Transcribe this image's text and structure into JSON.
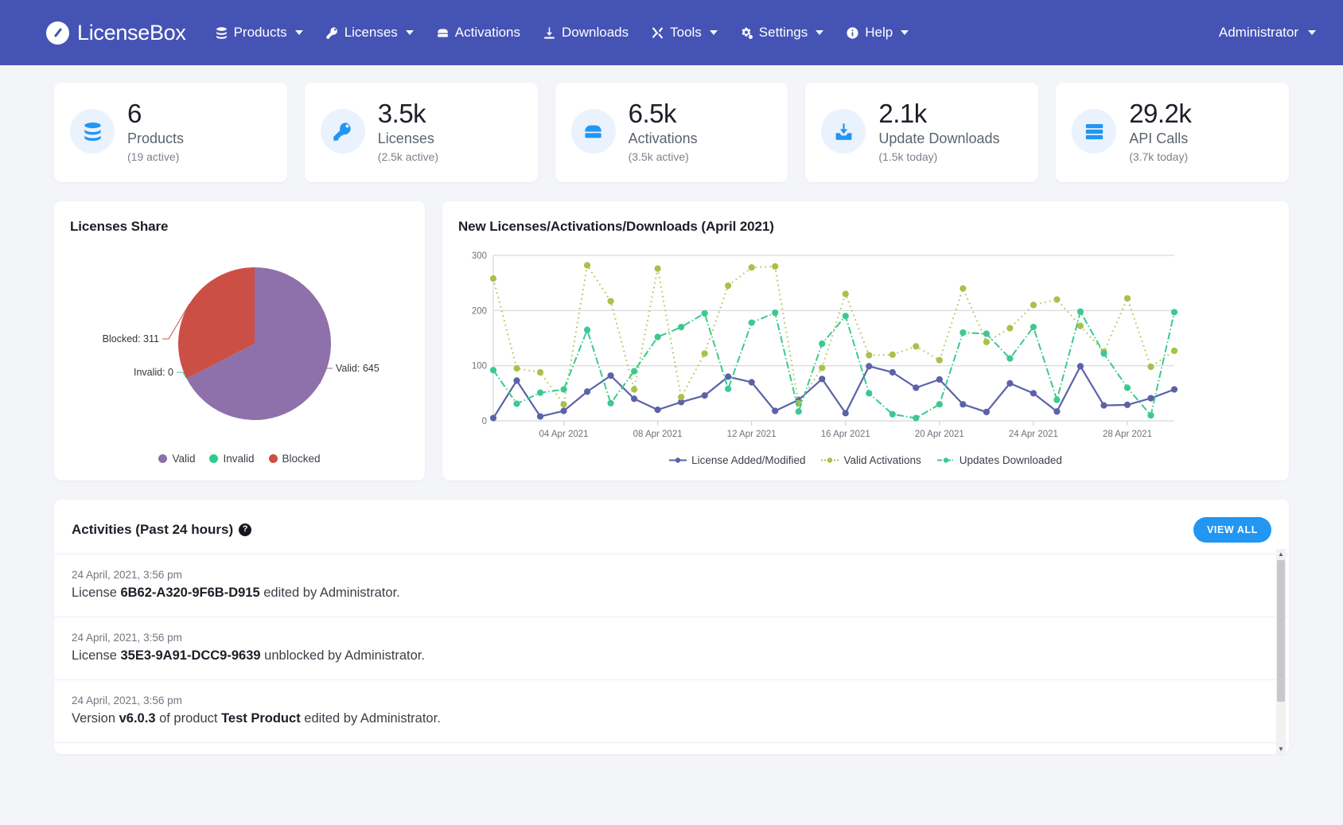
{
  "navbar": {
    "brand": "LicenseBox",
    "brand_icon": "licensebox-logo-icon",
    "items": [
      {
        "label": "Products",
        "icon": "database-icon",
        "caret": true
      },
      {
        "label": "Licenses",
        "icon": "key-icon",
        "caret": true
      },
      {
        "label": "Activations",
        "icon": "server-icon",
        "caret": false
      },
      {
        "label": "Downloads",
        "icon": "download-icon",
        "caret": false
      },
      {
        "label": "Tools",
        "icon": "tools-icon",
        "caret": true
      },
      {
        "label": "Settings",
        "icon": "gears-icon",
        "caret": true
      },
      {
        "label": "Help",
        "icon": "info-icon",
        "caret": true
      }
    ],
    "user": {
      "label": "Administrator",
      "caret": true
    },
    "bg_color": "#4553b5"
  },
  "stats": [
    {
      "value": "6",
      "label": "Products",
      "sub": "(19 active)",
      "icon": "database-icon"
    },
    {
      "value": "3.5k",
      "label": "Licenses",
      "sub": "(2.5k active)",
      "icon": "key-icon"
    },
    {
      "value": "6.5k",
      "label": "Activations",
      "sub": "(3.5k active)",
      "icon": "server-icon"
    },
    {
      "value": "2.1k",
      "label": "Update Downloads",
      "sub": "(1.5k today)",
      "icon": "download-box-icon"
    },
    {
      "value": "29.2k",
      "label": "API Calls",
      "sub": "(3.7k today)",
      "icon": "api-rack-icon"
    }
  ],
  "pie_card": {
    "title": "Licenses Share"
  },
  "line_card": {
    "title": "New Licenses/Activations/Downloads (April 2021)"
  },
  "activities": {
    "title": "Activities (Past 24 hours)",
    "help_icon": "question-mark-icon",
    "view_all_label": "VIEW ALL",
    "rows": [
      {
        "time": "24 April, 2021, 3:56 pm",
        "pre": "License ",
        "bold": "6B62-A320-9F6B-D915",
        "post": " edited by Administrator."
      },
      {
        "time": "24 April, 2021, 3:56 pm",
        "pre": "License ",
        "bold": "35E3-9A91-DCC9-9639",
        "post": " unblocked by Administrator."
      },
      {
        "time": "24 April, 2021, 3:56 pm",
        "pre": "Version ",
        "bold": "v6.0.3",
        "mid": " of product ",
        "bold2": "Test Product",
        "post": " edited by Administrator."
      }
    ]
  },
  "chart_data": [
    {
      "type": "pie",
      "title": "Licenses Share",
      "legend_position": "bottom",
      "labels": [
        "Valid",
        "Invalid",
        "Blocked"
      ],
      "values": [
        645,
        0,
        311
      ],
      "colors": [
        "#8e71ab",
        "#2ecc8f",
        "#cc4f45"
      ],
      "annotations": [
        "Valid: 645",
        "Invalid: 0",
        "Blocked: 311"
      ]
    },
    {
      "type": "line",
      "title": "New Licenses/Activations/Downloads (April 2021)",
      "xlabel": "",
      "ylabel": "",
      "ylim": [
        0,
        300
      ],
      "yticks": [
        0,
        100,
        200,
        300
      ],
      "grid": true,
      "legend_position": "bottom",
      "x": [
        "01 Apr 2021",
        "02 Apr 2021",
        "03 Apr 2021",
        "04 Apr 2021",
        "05 Apr 2021",
        "06 Apr 2021",
        "07 Apr 2021",
        "08 Apr 2021",
        "09 Apr 2021",
        "10 Apr 2021",
        "11 Apr 2021",
        "12 Apr 2021",
        "13 Apr 2021",
        "14 Apr 2021",
        "15 Apr 2021",
        "16 Apr 2021",
        "17 Apr 2021",
        "18 Apr 2021",
        "19 Apr 2021",
        "20 Apr 2021",
        "21 Apr 2021",
        "22 Apr 2021",
        "23 Apr 2021",
        "24 Apr 2021",
        "25 Apr 2021",
        "26 Apr 2021",
        "27 Apr 2021",
        "28 Apr 2021",
        "29 Apr 2021",
        "30 Apr 2021"
      ],
      "xtick_labels": [
        "04 Apr 2021",
        "08 Apr 2021",
        "12 Apr 2021",
        "16 Apr 2021",
        "20 Apr 2021",
        "24 Apr 2021",
        "28 Apr 2021"
      ],
      "xtick_indices": [
        3,
        7,
        11,
        15,
        19,
        23,
        27
      ],
      "series": [
        {
          "name": "License Added/Modified",
          "color": "#5b62a8",
          "style": "solid",
          "values": [
            5,
            73,
            8,
            18,
            53,
            82,
            40,
            20,
            34,
            46,
            80,
            70,
            18,
            38,
            76,
            14,
            99,
            88,
            60,
            75,
            30,
            16,
            68,
            50,
            17,
            99,
            28,
            29,
            41,
            57
          ]
        },
        {
          "name": "Valid Activations",
          "color": "#a8c14a",
          "style": "dotted",
          "values": [
            258,
            95,
            88,
            30,
            282,
            217,
            57,
            276,
            43,
            122,
            245,
            278,
            280,
            32,
            96,
            230,
            119,
            120,
            135,
            110,
            240,
            143,
            168,
            210,
            220,
            172,
            125,
            222,
            98,
            127
          ]
        },
        {
          "name": "Updates Downloaded",
          "color": "#3cc98f",
          "style": "dashdot",
          "values": [
            92,
            31,
            51,
            57,
            165,
            32,
            90,
            152,
            170,
            195,
            58,
            178,
            196,
            17,
            140,
            190,
            50,
            12,
            5,
            30,
            160,
            158,
            113,
            170,
            38,
            198,
            122,
            60,
            10,
            197
          ]
        }
      ]
    }
  ]
}
